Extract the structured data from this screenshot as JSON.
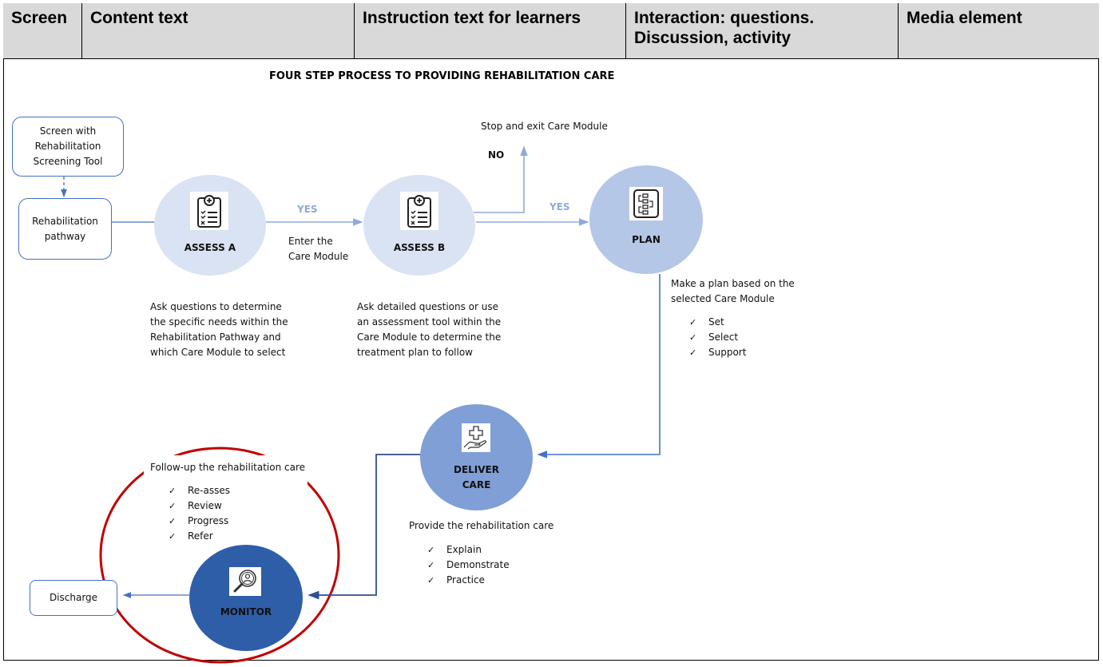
{
  "table_header": {
    "columns": [
      "Screen",
      "Content text",
      "Instruction text for learners",
      "Interaction: questions. Discussion, activity",
      "Media element"
    ]
  },
  "diagram": {
    "title": "FOUR STEP PROCESS TO PROVIDING REHABILITATION CARE",
    "boxes": {
      "screen_tool": "Screen with Rehabilitation Screening Tool",
      "pathway": "Rehabilitation pathway",
      "discharge": "Discharge"
    },
    "nodes": {
      "assess_a": {
        "label": "ASSESS A",
        "icon": "clipboard-checklist-icon",
        "color": "#dae3f3"
      },
      "assess_b": {
        "label": "ASSESS B",
        "icon": "clipboard-checklist-icon",
        "color": "#dae3f3"
      },
      "plan": {
        "label": "PLAN",
        "icon": "flowchart-plan-icon",
        "color": "#b4c7e7"
      },
      "deliver": {
        "label_line1": "DELIVER",
        "label_line2": "CARE",
        "icon": "hand-medical-cross-icon",
        "color": "#7f9fd6"
      },
      "monitor": {
        "label": "MONITOR",
        "icon": "magnifier-person-icon",
        "color": "#2f5ea8"
      }
    },
    "connectors": {
      "yes_1": "YES",
      "yes_2": "YES",
      "no": "NO",
      "enter_module_line1": "Enter the",
      "enter_module_line2": "Care Module",
      "stop_exit": "Stop and exit Care Module"
    },
    "descriptions": {
      "assess_a": [
        "Ask questions to determine",
        "the specific needs within the",
        "Rehabilitation Pathway and",
        "which Care Module to select"
      ],
      "assess_b": [
        "Ask detailed questions or use",
        "an assessment tool within the",
        "Care Module to determine the",
        "treatment plan to follow"
      ],
      "plan": {
        "lines": [
          "Make a plan based on the",
          "selected Care Module"
        ],
        "checklist": [
          "Set",
          "Select",
          "Support"
        ]
      },
      "deliver": {
        "lines": [
          "Provide the rehabilitation care"
        ],
        "checklist": [
          "Explain",
          "Demonstrate",
          "Practice"
        ]
      },
      "monitor": {
        "lines": [
          "Follow-up the rehabilitation care"
        ],
        "checklist": [
          "Re-asses",
          "Review",
          "Progress",
          "Refer"
        ]
      }
    },
    "colors": {
      "arrow_light": "#8eaadb",
      "arrow_mid": "#4472c4",
      "arrow_dark": "#2f4f8f",
      "highlight_ring": "#c00000"
    }
  }
}
